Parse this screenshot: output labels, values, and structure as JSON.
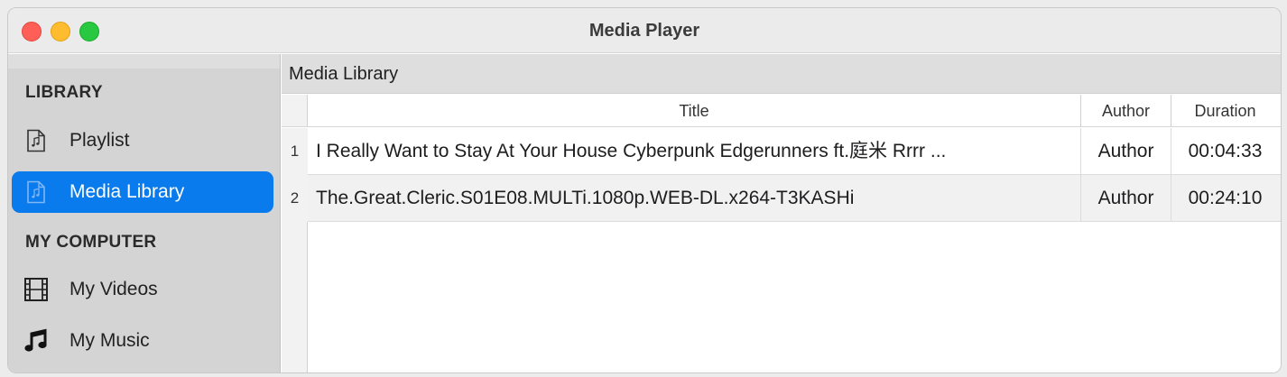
{
  "window": {
    "title": "Media Player"
  },
  "sidebar": {
    "sections": [
      {
        "header": "LIBRARY",
        "items": [
          {
            "label": "Playlist",
            "icon": "music-file-icon",
            "selected": false
          },
          {
            "label": "Media Library",
            "icon": "music-file-icon",
            "selected": true
          }
        ]
      },
      {
        "header": "MY COMPUTER",
        "items": [
          {
            "label": "My Videos",
            "icon": "film-icon",
            "selected": false
          },
          {
            "label": "My Music",
            "icon": "music-note-icon",
            "selected": false
          }
        ]
      }
    ]
  },
  "main": {
    "header": "Media Library",
    "table": {
      "columns": [
        "Title",
        "Author",
        "Duration"
      ],
      "rows": [
        {
          "num": "1",
          "title": "I Really Want to Stay At Your House  Cyberpunk Edgerunners  ft.庭米  Rrrr ...",
          "author": "Author",
          "duration": "00:04:33"
        },
        {
          "num": "2",
          "title": "The.Great.Cleric.S01E08.MULTi.1080p.WEB-DL.x264-T3KASHi",
          "author": "Author",
          "duration": "00:24:10"
        }
      ]
    }
  },
  "colors": {
    "accent": "#0a7bed",
    "close": "#ff5f57",
    "minimize": "#febc2e",
    "maximize": "#28c840"
  }
}
